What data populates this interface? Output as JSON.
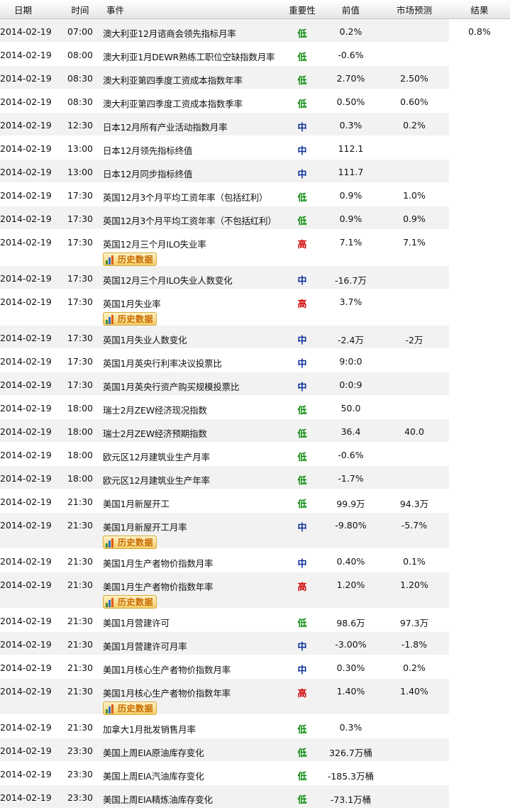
{
  "header": {
    "date": "日期",
    "time": "时间",
    "event": "事件",
    "importance": "重要性",
    "previous": "前值",
    "forecast": "市场预测",
    "result": "结果"
  },
  "history_label": "历史数据",
  "colors": {
    "low": "#0a8a0a",
    "mid": "#0b2f9b",
    "high": "#d10b0b",
    "stripe": "#f2f2f2"
  },
  "rows": [
    {
      "date": "2014-02-19",
      "time": "07:00",
      "event": "澳大利亚12月谘商会领先指标月率",
      "importance": "低",
      "level": "low",
      "previous": "0.2%",
      "forecast": "",
      "result": "0.8%",
      "history": false
    },
    {
      "date": "2014-02-19",
      "time": "08:00",
      "event": "澳大利亚1月DEWR熟练工职位空缺指数月率",
      "importance": "低",
      "level": "low",
      "previous": "-0.6%",
      "forecast": "",
      "result": "",
      "history": false
    },
    {
      "date": "2014-02-19",
      "time": "08:30",
      "event": "澳大利亚第四季度工资成本指数年率",
      "importance": "低",
      "level": "low",
      "previous": "2.70%",
      "forecast": "2.50%",
      "result": "",
      "history": false
    },
    {
      "date": "2014-02-19",
      "time": "08:30",
      "event": "澳大利亚第四季度工资成本指数季率",
      "importance": "低",
      "level": "low",
      "previous": "0.50%",
      "forecast": "0.60%",
      "result": "",
      "history": false
    },
    {
      "date": "2014-02-19",
      "time": "12:30",
      "event": "日本12月所有产业活动指数月率",
      "importance": "中",
      "level": "mid",
      "previous": "0.3%",
      "forecast": "0.2%",
      "result": "",
      "history": false
    },
    {
      "date": "2014-02-19",
      "time": "13:00",
      "event": "日本12月领先指标终值",
      "importance": "中",
      "level": "mid",
      "previous": "112.1",
      "forecast": "",
      "result": "",
      "history": false
    },
    {
      "date": "2014-02-19",
      "time": "13:00",
      "event": "日本12月同步指标终值",
      "importance": "中",
      "level": "mid",
      "previous": "111.7",
      "forecast": "",
      "result": "",
      "history": false
    },
    {
      "date": "2014-02-19",
      "time": "17:30",
      "event": "英国12月3个月平均工资年率（包括红利）",
      "importance": "低",
      "level": "low",
      "previous": "0.9%",
      "forecast": "1.0%",
      "result": "",
      "history": false
    },
    {
      "date": "2014-02-19",
      "time": "17:30",
      "event": "英国12月3个月平均工资年率（不包括红利）",
      "importance": "低",
      "level": "low",
      "previous": "0.9%",
      "forecast": "0.9%",
      "result": "",
      "history": false
    },
    {
      "date": "2014-02-19",
      "time": "17:30",
      "event": "英国12月三个月ILO失业率",
      "importance": "高",
      "level": "high",
      "previous": "7.1%",
      "forecast": "7.1%",
      "result": "",
      "history": true
    },
    {
      "date": "2014-02-19",
      "time": "17:30",
      "event": "英国12月三个月ILO失业人数变化",
      "importance": "中",
      "level": "mid",
      "previous": "-16.7万",
      "forecast": "",
      "result": "",
      "history": false
    },
    {
      "date": "2014-02-19",
      "time": "17:30",
      "event": "英国1月失业率",
      "importance": "高",
      "level": "high",
      "previous": "3.7%",
      "forecast": "",
      "result": "",
      "history": true
    },
    {
      "date": "2014-02-19",
      "time": "17:30",
      "event": "英国1月失业人数变化",
      "importance": "中",
      "level": "mid",
      "previous": "-2.4万",
      "forecast": "-2万",
      "result": "",
      "history": false
    },
    {
      "date": "2014-02-19",
      "time": "17:30",
      "event": "英国1月英央行利率决议投票比",
      "importance": "中",
      "level": "mid",
      "previous": "9:0:0",
      "forecast": "",
      "result": "",
      "history": false
    },
    {
      "date": "2014-02-19",
      "time": "17:30",
      "event": "英国1月英央行资产购买规模投票比",
      "importance": "中",
      "level": "mid",
      "previous": "0:0:9",
      "forecast": "",
      "result": "",
      "history": false
    },
    {
      "date": "2014-02-19",
      "time": "18:00",
      "event": "瑞士2月ZEW经济现况指数",
      "importance": "低",
      "level": "low",
      "previous": "50.0",
      "forecast": "",
      "result": "",
      "history": false
    },
    {
      "date": "2014-02-19",
      "time": "18:00",
      "event": "瑞士2月ZEW经济预期指数",
      "importance": "低",
      "level": "low",
      "previous": "36.4",
      "forecast": "40.0",
      "result": "",
      "history": false
    },
    {
      "date": "2014-02-19",
      "time": "18:00",
      "event": "欧元区12月建筑业生产月率",
      "importance": "低",
      "level": "low",
      "previous": "-0.6%",
      "forecast": "",
      "result": "",
      "history": false
    },
    {
      "date": "2014-02-19",
      "time": "18:00",
      "event": "欧元区12月建筑业生产年率",
      "importance": "低",
      "level": "low",
      "previous": "-1.7%",
      "forecast": "",
      "result": "",
      "history": false
    },
    {
      "date": "2014-02-19",
      "time": "21:30",
      "event": "美国1月新屋开工",
      "importance": "低",
      "level": "low",
      "previous": "99.9万",
      "forecast": "94.3万",
      "result": "",
      "history": false
    },
    {
      "date": "2014-02-19",
      "time": "21:30",
      "event": "美国1月新屋开工月率",
      "importance": "中",
      "level": "mid",
      "previous": "-9.80%",
      "forecast": "-5.7%",
      "result": "",
      "history": true
    },
    {
      "date": "2014-02-19",
      "time": "21:30",
      "event": "美国1月生产者物价指数月率",
      "importance": "中",
      "level": "mid",
      "previous": "0.40%",
      "forecast": "0.1%",
      "result": "",
      "history": false
    },
    {
      "date": "2014-02-19",
      "time": "21:30",
      "event": "美国1月生产者物价指数年率",
      "importance": "高",
      "level": "high",
      "previous": "1.20%",
      "forecast": "1.20%",
      "result": "",
      "history": true
    },
    {
      "date": "2014-02-19",
      "time": "21:30",
      "event": "美国1月营建许可",
      "importance": "低",
      "level": "low",
      "previous": "98.6万",
      "forecast": "97.3万",
      "result": "",
      "history": false
    },
    {
      "date": "2014-02-19",
      "time": "21:30",
      "event": "美国1月营建许可月率",
      "importance": "中",
      "level": "mid",
      "previous": "-3.00%",
      "forecast": "-1.8%",
      "result": "",
      "history": false
    },
    {
      "date": "2014-02-19",
      "time": "21:30",
      "event": "美国1月核心生产者物价指数月率",
      "importance": "中",
      "level": "mid",
      "previous": "0.30%",
      "forecast": "0.2%",
      "result": "",
      "history": false
    },
    {
      "date": "2014-02-19",
      "time": "21:30",
      "event": "美国1月核心生产者物价指数年率",
      "importance": "高",
      "level": "high",
      "previous": "1.40%",
      "forecast": "1.40%",
      "result": "",
      "history": true
    },
    {
      "date": "2014-02-19",
      "time": "21:30",
      "event": "加拿大1月批发销售月率",
      "importance": "低",
      "level": "low",
      "previous": "0.3%",
      "forecast": "",
      "result": "",
      "history": false
    },
    {
      "date": "2014-02-19",
      "time": "23:30",
      "event": "美国上周EIA原油库存变化",
      "importance": "低",
      "level": "low",
      "previous": "326.7万桶",
      "forecast": "",
      "result": "",
      "history": false
    },
    {
      "date": "2014-02-19",
      "time": "23:30",
      "event": "美国上周EIA汽油库存变化",
      "importance": "低",
      "level": "low",
      "previous": "-185.3万桶",
      "forecast": "",
      "result": "",
      "history": false
    },
    {
      "date": "2014-02-19",
      "time": "23:30",
      "event": "美国上周EIA精炼油库存变化",
      "importance": "低",
      "level": "low",
      "previous": "-73.1万桶",
      "forecast": "",
      "result": "",
      "history": false
    }
  ]
}
